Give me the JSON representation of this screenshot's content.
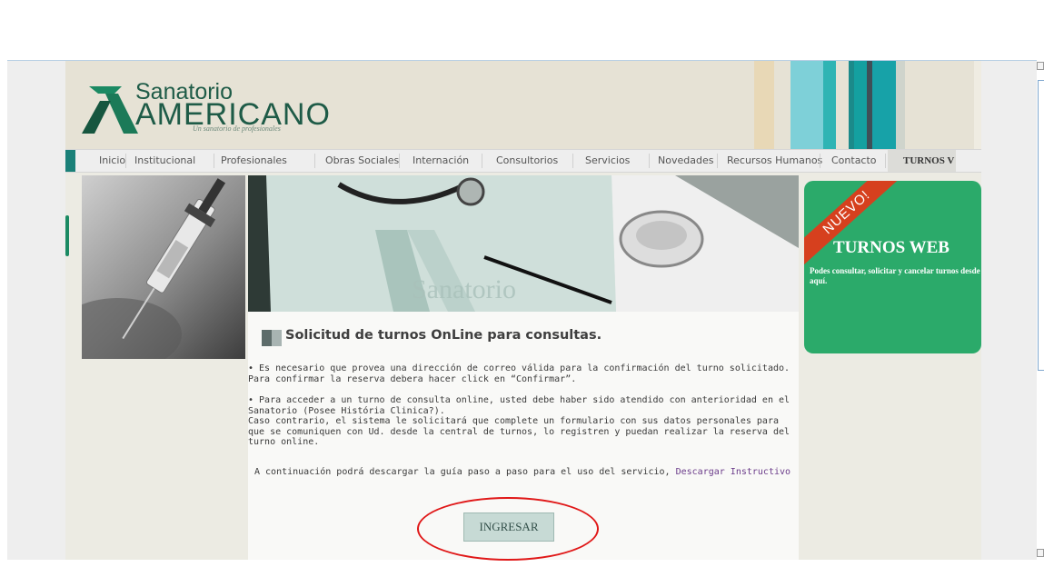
{
  "header": {
    "logo_line1": "Sanatorio",
    "logo_line2": "AMERICANO",
    "slogan": "Un sanatorio de profesionales"
  },
  "nav": {
    "items": [
      {
        "label": "Inicio"
      },
      {
        "label": "Institucional"
      },
      {
        "label": "Profesionales"
      },
      {
        "label": "Obras Sociales"
      },
      {
        "label": "Internación"
      },
      {
        "label": "Consultorios"
      },
      {
        "label": "Servicios"
      },
      {
        "label": "Novedades"
      },
      {
        "label": "Recursos Humanos"
      },
      {
        "label": "Contacto"
      },
      {
        "label": "TURNOS V"
      }
    ]
  },
  "promo": {
    "ribbon": "NUEVO!",
    "title": "TURNOS WEB",
    "text": "Podes consultar, solicitar y cancelar turnos desde aquí."
  },
  "content": {
    "heading": "Solicitud de turnos OnLine para consultas.",
    "p1": "• Es necesario que provea una dirección de correo válida para la confirmación del turno solicitado. Para confirmar la reserva debera hacer click en “Confirmar”.",
    "p2": "• Para acceder a un turno de consulta online, usted debe haber sido atendido con anterioridad en el Sanatorio (Posee História Clinica?).",
    "p3": "Caso contrario, el sistema le solicitará que complete un formulario con sus datos personales para que se comuniquen con Ud. desde la central de turnos, lo registren y puedan realizar la reserva del turno online.",
    "p4_text": "A continuación podrá descargar la guía paso a paso para el uso del servicio,",
    "p4_link": "Descargar Instructivo",
    "button": "INGRESAR"
  },
  "colors": {
    "brand_green": "#1e5b47",
    "teal": "#1a8078",
    "promo_green": "#2baa6a",
    "ribbon_red": "#d6401e",
    "annotation_red": "#e01818"
  }
}
